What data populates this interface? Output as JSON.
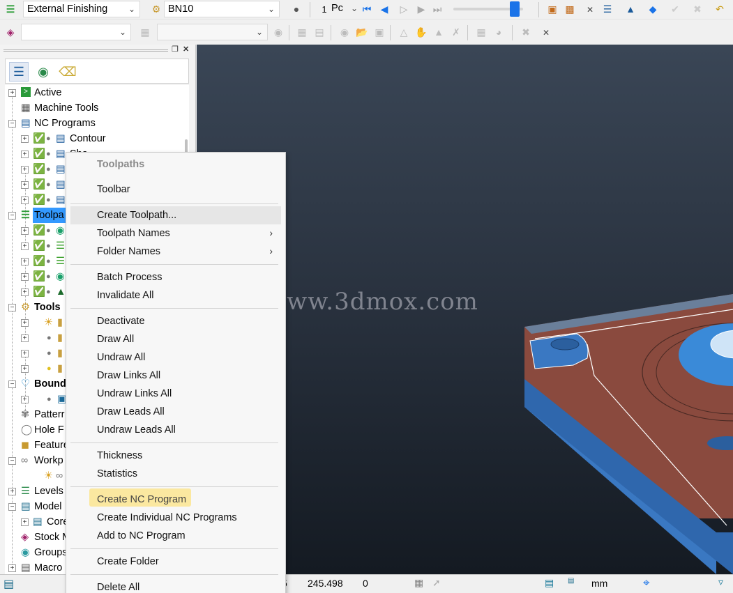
{
  "toolbar1": {
    "strategy_combo": "External Finishing",
    "tool_combo": "BN10",
    "nc_label": "1",
    "nc_combo": "Pc"
  },
  "toolbar2": {
    "combo1": "",
    "combo2": ""
  },
  "explorer": {
    "tree": {
      "active": "Active",
      "machine_tools": "Machine Tools",
      "nc_programs": "NC Programs",
      "contour": "Contour",
      "cut_item": "Sha",
      "toolpaths": "Toolpa",
      "tools": "Tools",
      "boundaries": "Bound",
      "patterns": "Patterr",
      "holes": "Hole F",
      "features": "Feature",
      "workplanes": "Workp",
      "levels": "Levels",
      "models": "Model",
      "core": "Core",
      "stock": "Stock M",
      "groups": "Groups",
      "macros": "Macro"
    }
  },
  "viewport": {
    "watermark": "网www.3dmox.com"
  },
  "status": {
    "val1": "5",
    "val2": "245.498",
    "val3": "0",
    "units": "mm"
  },
  "context_menu": {
    "header": "Toolpaths",
    "items": {
      "toolbar": "Toolbar",
      "create_toolpath": "Create Toolpath...",
      "toolpath_names": "Toolpath Names",
      "folder_names": "Folder Names",
      "batch_process": "Batch Process",
      "invalidate_all": "Invalidate All",
      "deactivate": "Deactivate",
      "draw_all": "Draw All",
      "undraw_all": "Undraw All",
      "draw_links_all": "Draw Links All",
      "undraw_links_all": "Undraw Links All",
      "draw_leads_all": "Draw Leads All",
      "undraw_leads_all": "Undraw Leads All",
      "thickness": "Thickness",
      "statistics": "Statistics",
      "create_nc_program": "Create NC Program",
      "create_individual_nc": "Create Individual NC Programs",
      "add_to_nc": "Add to NC Program",
      "create_folder": "Create Folder",
      "delete_all": "Delete All"
    }
  },
  "colors": {
    "model_top": "#8a4a3e",
    "model_side": "#3a78c2",
    "highlight": "#fbe8a0",
    "selection": "#3399ff"
  }
}
